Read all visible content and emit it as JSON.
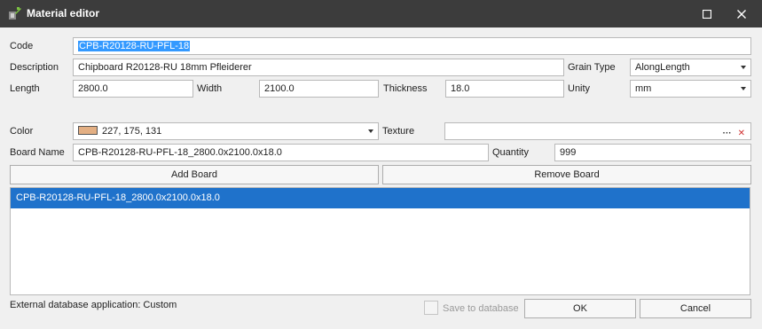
{
  "window": {
    "title": "Material editor",
    "maximize_glyph": "☐",
    "close_glyph": "✕"
  },
  "form": {
    "code": {
      "label": "Code",
      "value": "CPB-R20128-RU-PFL-18"
    },
    "description": {
      "label": "Description",
      "value": "Chipboard R20128-RU 18mm Pfleiderer"
    },
    "grain_type": {
      "label": "Grain Type",
      "value": "AlongLength"
    },
    "length": {
      "label": "Length",
      "value": "2800.0"
    },
    "width": {
      "label": "Width",
      "value": "2100.0"
    },
    "thickness": {
      "label": "Thickness",
      "value": "18.0"
    },
    "unity": {
      "label": "Unity",
      "value": "mm"
    },
    "color": {
      "label": "Color",
      "value": "227, 175, 131",
      "swatch": "#e3af83"
    },
    "texture": {
      "label": "Texture",
      "value": "",
      "browse_glyph": "···",
      "clear_glyph": "✕"
    },
    "board_name": {
      "label": "Board Name",
      "value": "CPB-R20128-RU-PFL-18_2800.0x2100.0x18.0"
    },
    "quantity": {
      "label": "Quantity",
      "value": "999"
    }
  },
  "buttons": {
    "add_board": "Add Board",
    "remove_board": "Remove Board",
    "ok": "OK",
    "cancel": "Cancel"
  },
  "boards": [
    "CPB-R20128-RU-PFL-18_2800.0x2100.0x18.0"
  ],
  "footer": {
    "external_db": "External database application: Custom",
    "save_to_db": "Save to database"
  },
  "colors": {
    "titlebar": "#3c3c3c",
    "selection": "#1f72cb",
    "text_selection": "#3399ff",
    "clear_red": "#d03030"
  }
}
